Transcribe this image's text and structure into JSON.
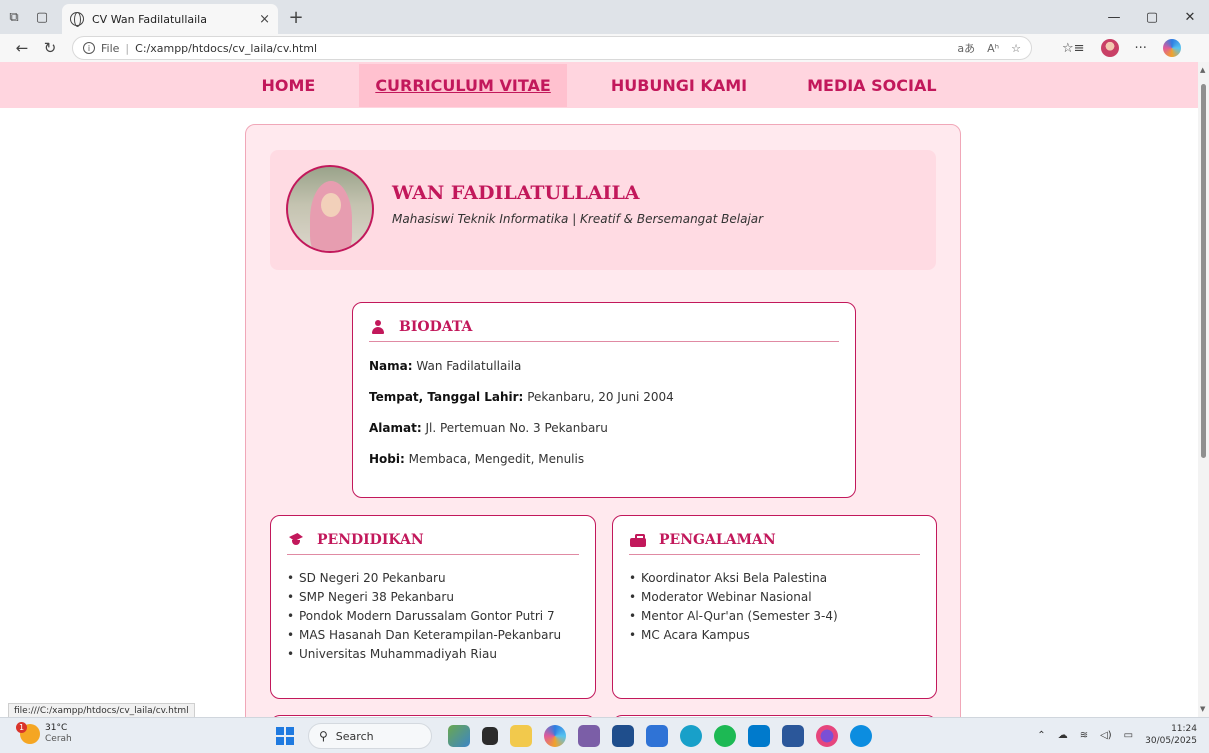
{
  "browser": {
    "tab_title": "CV Wan Fadilatullaila",
    "tab_close": "×",
    "new_tab": "+",
    "address_prefix": "File",
    "address_url": "C:/xampp/htdocs/cv_laila/cv.html",
    "status_url": "file:///C:/xampp/htdocs/cv_laila/cv.html",
    "read_aloud": "aあ",
    "text_size": "Aʰ"
  },
  "nav": {
    "items": [
      "HOME",
      "CURRICULUM VITAE",
      "HUBUNGI KAMI",
      "MEDIA SOCIAL"
    ]
  },
  "profile": {
    "name": "WAN FADILATULLAILA",
    "tagline": "Mahasiswi Teknik Informatika | Kreatif & Bersemangat Belajar"
  },
  "biodata": {
    "title": "BIODATA",
    "rows": [
      {
        "label": "Nama:",
        "value": "Wan Fadilatullaila"
      },
      {
        "label": "Tempat, Tanggal Lahir:",
        "value": "Pekanbaru, 20 Juni 2004"
      },
      {
        "label": "Alamat:",
        "value": "Jl. Pertemuan No. 3 Pekanbaru"
      },
      {
        "label": "Hobi:",
        "value": "Membaca, Mengedit, Menulis"
      }
    ]
  },
  "pendidikan": {
    "title": "PENDIDIKAN",
    "items": [
      "SD Negeri 20 Pekanbaru",
      "SMP Negeri 38 Pekanbaru",
      "Pondok Modern Darussalam Gontor Putri 7",
      "MAS Hasanah Dan Keterampilan-Pekanbaru",
      "Universitas Muhammadiyah Riau"
    ]
  },
  "pengalaman": {
    "title": "PENGALAMAN",
    "items": [
      "Koordinator Aksi Bela Palestina",
      "Moderator Webinar Nasional",
      "Mentor Al-Qur'an (Semester 3-4)",
      "MC Acara Kampus"
    ]
  },
  "taskbar": {
    "weather_temp": "31°C",
    "weather_cond": "Cerah",
    "weather_badge": "1",
    "search_label": "Search",
    "time": "11:24",
    "date": "30/05/2025"
  },
  "colors": {
    "accent": "#c2185b",
    "nav_bg": "#ffd5df",
    "card_bg": "#ffe9ee"
  }
}
